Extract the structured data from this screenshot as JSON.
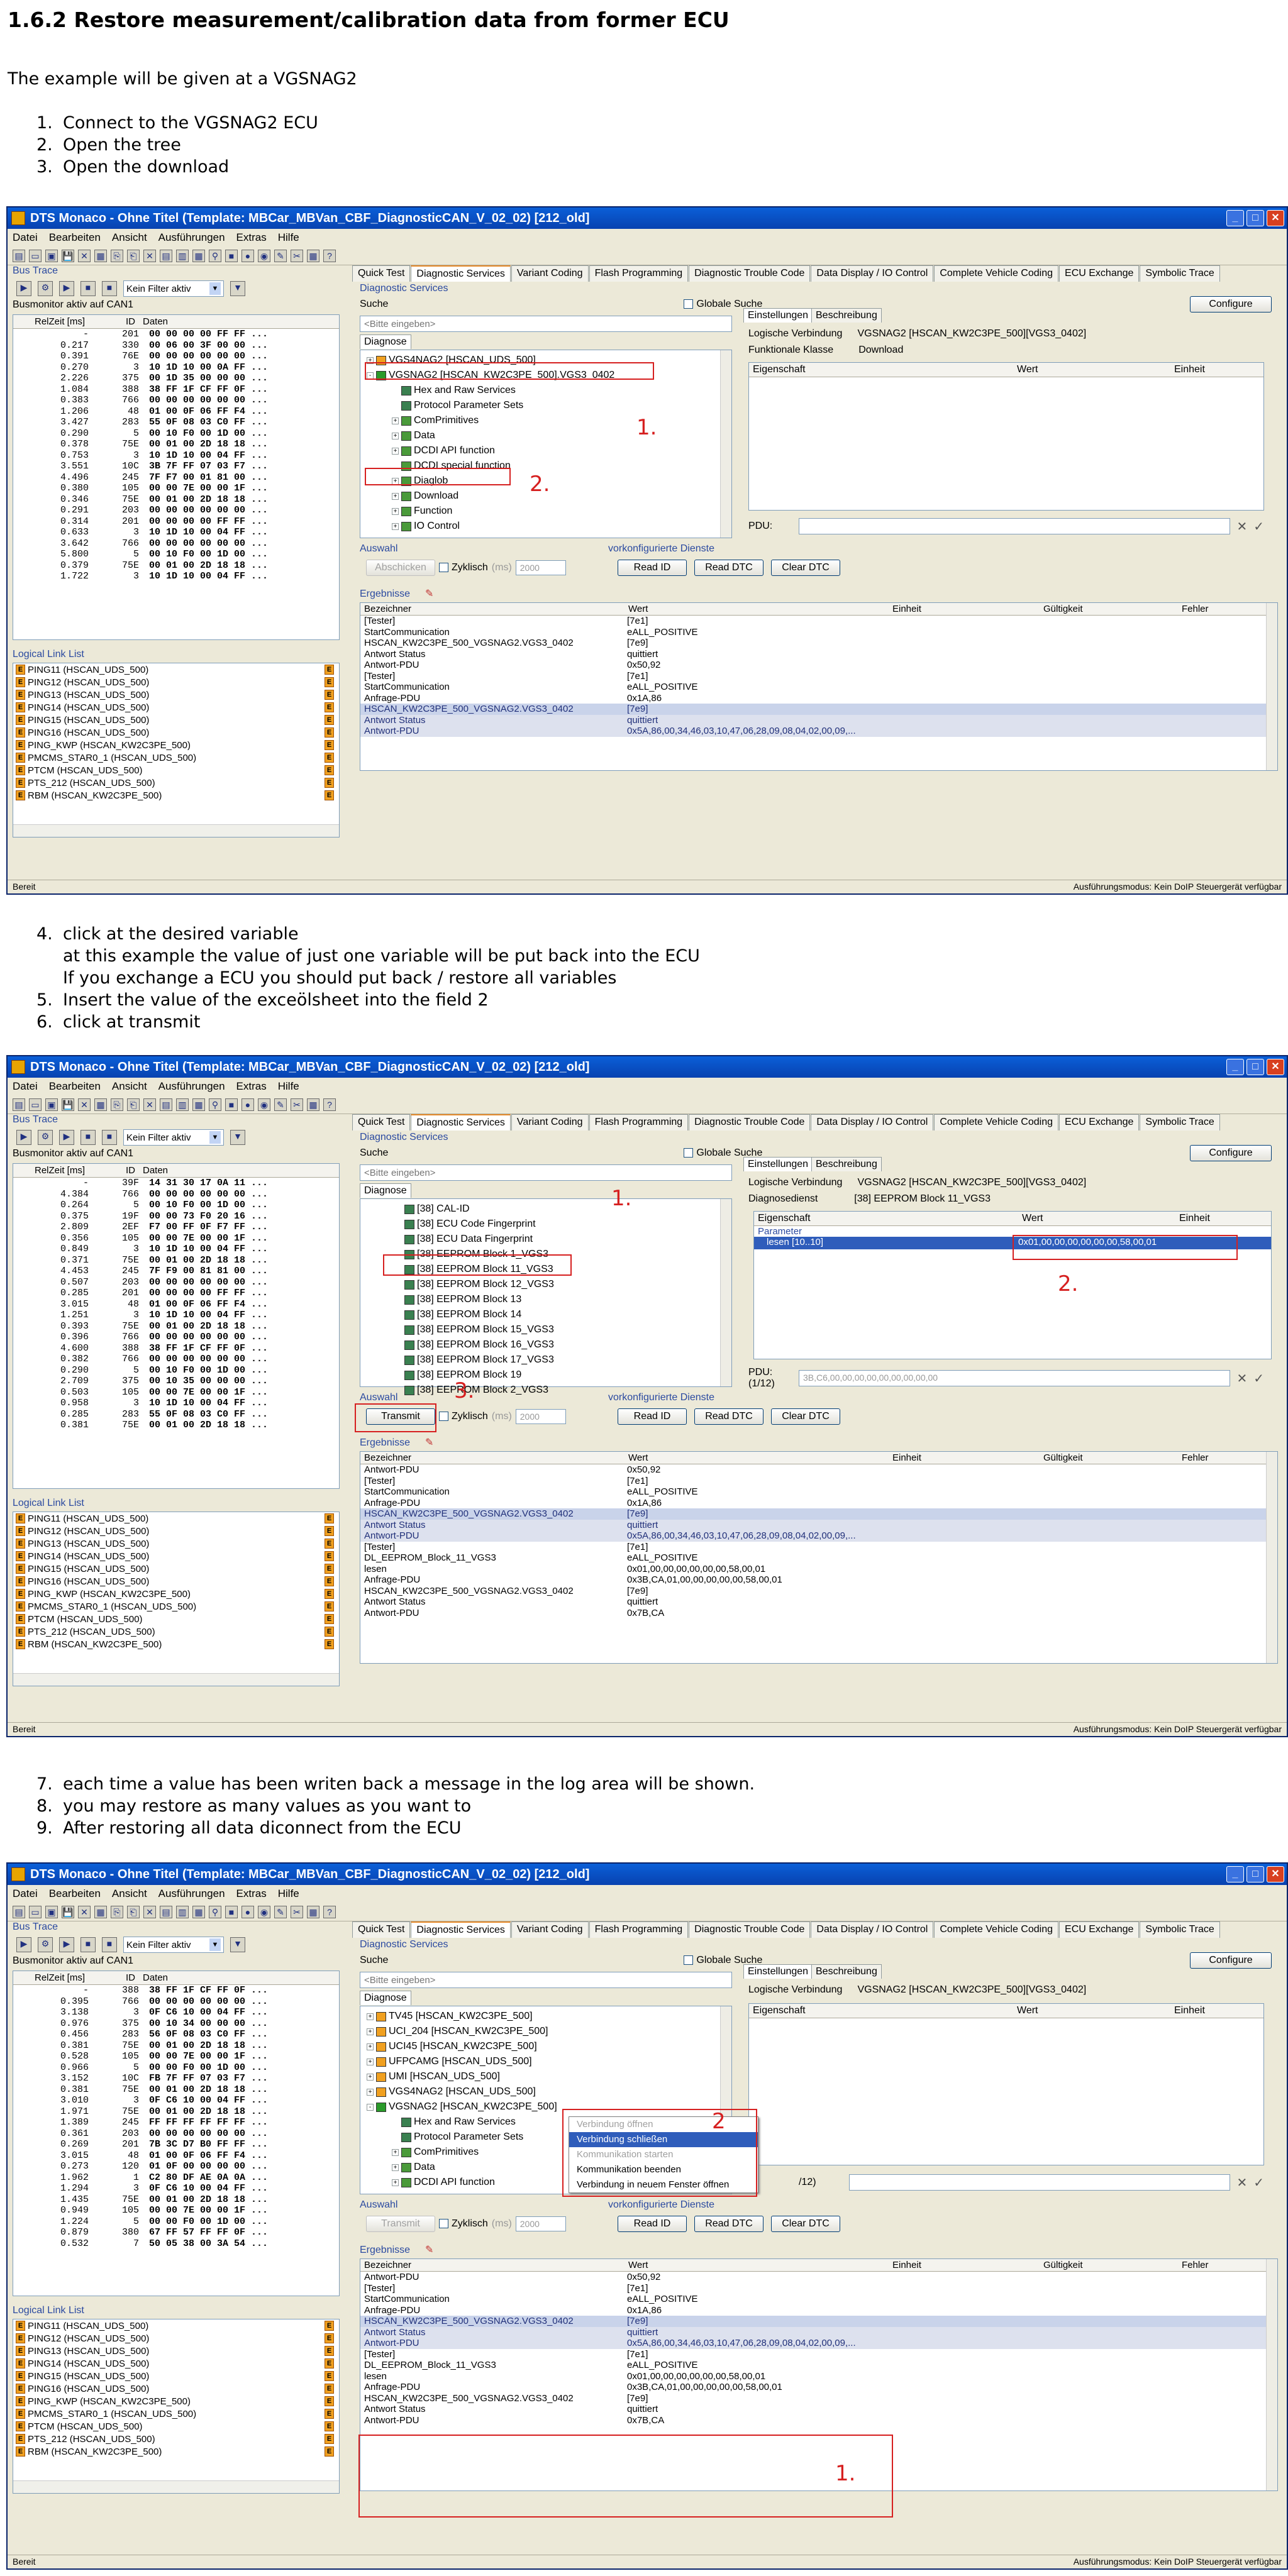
{
  "doc": {
    "heading": "1.6.2 Restore measurement/calibration data from former ECU",
    "intro": "The example will be given at a VGSNAG2",
    "steps_a": [
      {
        "n": "1.",
        "text": "Connect to the VGSNAG2 ECU"
      },
      {
        "n": "2.",
        "text": "Open the tree"
      },
      {
        "n": "3.",
        "text": "Open the download"
      }
    ],
    "steps_b": [
      {
        "n": "4.",
        "text": "click at the desired variable"
      },
      {
        "n": "",
        "text": "at this example the value of just one variable will be put back into the ECU"
      },
      {
        "n": "",
        "text": "If you exchange a ECU you should put back / restore all variables"
      },
      {
        "n": "5.",
        "text": "Insert the value of the exceölsheet into the field 2"
      },
      {
        "n": "6.",
        "text": "click at transmit"
      }
    ],
    "steps_c": [
      {
        "n": "7.",
        "text": "each time a value has been writen back a message in the log area will be shown."
      },
      {
        "n": "8.",
        "text": "you may restore as many values as you want to"
      },
      {
        "n": "9.",
        "text": "After restoring all data diconnect from the ECU"
      }
    ]
  },
  "window": {
    "title": "DTS Monaco - Ohne Titel (Template: MBCar_MBVan_CBF_DiagnosticCAN_V_02_02) [212_old]",
    "menu": [
      "Datei",
      "Bearbeiten",
      "Ansicht",
      "Ausführungen",
      "Extras",
      "Hilfe"
    ],
    "tabs": [
      "Quick Test",
      "Diagnostic Services",
      "Variant Coding",
      "Flash Programming",
      "Diagnostic Trouble Code",
      "Data Display / IO Control",
      "Complete Vehicle Coding",
      "ECU Exchange",
      "Symbolic Trace"
    ],
    "bus_trace": "Bus Trace",
    "filter": "Kein Filter aktiv",
    "busmonitor": "Busmonitor aktiv auf CAN1",
    "bus_cols": [
      "RelZeit [ms]",
      "ID",
      "Daten"
    ],
    "logical_link_list": "Logical Link List",
    "links": [
      "PING11 (HSCAN_UDS_500)",
      "PING12 (HSCAN_UDS_500)",
      "PING13 (HSCAN_UDS_500)",
      "PING14 (HSCAN_UDS_500)",
      "PING15 (HSCAN_UDS_500)",
      "PING16 (HSCAN_UDS_500)",
      "PING_KWP (HSCAN_KW2C3PE_500)",
      "PMCMS_STAR0_1 (HSCAN_UDS_500)",
      "PTCM (HSCAN_UDS_500)",
      "PTS_212 (HSCAN_UDS_500)",
      "RBM (HSCAN_KW2C3PE_500)"
    ],
    "diag_services": "Diagnostic Services",
    "suche": "Suche",
    "globale_suche": "Globale Suche",
    "configure": "Configure",
    "search_placeholder": "<Bitte eingeben>",
    "diagnose_tab": "Diagnose",
    "einstellungen_tab": "Einstellungen",
    "beschreibung_tab": "Beschreibung",
    "log_verb_label": "Logische Verbindung",
    "log_verb_value": "VGSNAG2 [HSCAN_KW2C3PE_500][VGS3_0402]",
    "props_cols": [
      "Eigenschaft",
      "Wert",
      "Einheit"
    ],
    "pdu": "PDU:",
    "auswahl": "Auswahl",
    "zyklisch": "Zyklisch",
    "ms": "(ms)",
    "cycle_value": "2000",
    "vorkonfig": "vorkonfigurierte Dienste",
    "read_id": "Read ID",
    "read_dtc": "Read DTC",
    "clear_dtc": "Clear DTC",
    "ergebnisse": "Ergebnisse",
    "res_cols": [
      "Bezeichner",
      "Wert",
      "Einheit",
      "Gültigkeit",
      "Fehler"
    ],
    "bereit": "Bereit",
    "ausf_mode": "Ausführungsmodus: Kein DoIP Steuergerät verfügbar"
  },
  "shot1": {
    "tree": [
      {
        "pm": "+",
        "ico": "e",
        "label": "VGS4NAG2 [HSCAN_UDS_500]",
        "indent": 0
      },
      {
        "pm": "-",
        "ico": "v",
        "label": "VGSNAG2 [HSCAN_KW2C3PE_500].VGS3_0402",
        "indent": 0
      },
      {
        "pm": "",
        "ico": "s",
        "label": "Hex and Raw Services",
        "indent": 1
      },
      {
        "pm": "",
        "ico": "s",
        "label": "Protocol Parameter Sets",
        "indent": 1
      },
      {
        "pm": "+",
        "ico": "g",
        "label": "ComPrimitives",
        "indent": 1
      },
      {
        "pm": "+",
        "ico": "g",
        "label": "Data",
        "indent": 1
      },
      {
        "pm": "+",
        "ico": "g",
        "label": "DCDI API function",
        "indent": 1
      },
      {
        "pm": "",
        "ico": "g",
        "label": "DCDI special function",
        "indent": 1
      },
      {
        "pm": "+",
        "ico": "g",
        "label": "Diaglob",
        "indent": 1
      },
      {
        "pm": "+",
        "ico": "g",
        "label": "Download",
        "indent": 1
      },
      {
        "pm": "+",
        "ico": "g",
        "label": "Function",
        "indent": 1
      },
      {
        "pm": "+",
        "ico": "g",
        "label": "IO Control",
        "indent": 1
      }
    ],
    "funk_label": "Funktionale Klasse",
    "funk_value": "Download",
    "abschicken": "Abschicken",
    "bus": [
      [
        "-",
        "201",
        "00 00 00 00 FF FF ..."
      ],
      [
        "0.217",
        "330",
        "00 06 00 3F 00 00 ..."
      ],
      [
        "0.391",
        "76E",
        "00 00 00 00 00 00 ..."
      ],
      [
        "0.270",
        "3",
        "10 1D 10 00 0A FF ..."
      ],
      [
        "2.226",
        "375",
        "00 1D 35 00 00 00 ..."
      ],
      [
        "1.084",
        "388",
        "38 FF 1F CF FF 0F ..."
      ],
      [
        "0.383",
        "766",
        "00 00 00 00 00 00 ..."
      ],
      [
        "1.206",
        "48",
        "01 00 0F 06 FF F4 ..."
      ],
      [
        "3.427",
        "283",
        "55 0F 08 03 C0 FF ..."
      ],
      [
        "0.290",
        "5",
        "00 10 F0 00 1D 00 ..."
      ],
      [
        "0.378",
        "75E",
        "00 01 00 2D 18 18 ..."
      ],
      [
        "0.753",
        "3",
        "10 1D 10 00 04 FF ..."
      ],
      [
        "3.551",
        "10C",
        "3B 7F FF 07 03 F7 ..."
      ],
      [
        "4.496",
        "245",
        "7F F7 00 01 81 00 ..."
      ],
      [
        "0.380",
        "105",
        "00 00 7E 00 00 1F ..."
      ],
      [
        "0.346",
        "75E",
        "00 01 00 2D 18 18 ..."
      ],
      [
        "0.291",
        "203",
        "00 00 00 00 00 00 ..."
      ],
      [
        "0.314",
        "201",
        "00 00 00 00 FF FF ..."
      ],
      [
        "0.633",
        "3",
        "10 1D 10 00 04 FF ..."
      ],
      [
        "3.642",
        "766",
        "00 00 00 00 00 00 ..."
      ],
      [
        "5.800",
        "5",
        "00 10 F0 00 1D 00 ..."
      ],
      [
        "0.379",
        "75E",
        "00 01 00 2D 18 18 ..."
      ],
      [
        "1.722",
        "3",
        "10 1D 10 00 04 FF ..."
      ]
    ],
    "results": [
      {
        "b": "[Tester]",
        "w": "[7e1]",
        "s": ""
      },
      {
        "b": "StartCommunication",
        "w": "eALL_POSITIVE",
        "s": ""
      },
      {
        "b": "HSCAN_KW2C3PE_500_VGSNAG2.VGS3_0402",
        "w": "[7e9]",
        "s": ""
      },
      {
        "b": "Antwort Status",
        "w": "quittiert",
        "s": ""
      },
      {
        "b": "Antwort-PDU",
        "w": "0x50,92",
        "s": ""
      },
      {
        "b": "[Tester]",
        "w": "[7e1]",
        "s": ""
      },
      {
        "b": "StartCommunication",
        "w": "eALL_POSITIVE",
        "s": ""
      },
      {
        "b": "Anfrage-PDU",
        "w": "0x1A,86",
        "s": ""
      },
      {
        "b": "HSCAN_KW2C3PE_500_VGSNAG2.VGS3_0402",
        "w": "[7e9]",
        "s": "s"
      },
      {
        "b": "Antwort Status",
        "w": "quittiert",
        "s": "s2"
      },
      {
        "b": "Antwort-PDU",
        "w": "0x5A,86,00,34,46,03,10,47,06,28,09,08,04,02,00,09,...",
        "s": "s2"
      }
    ],
    "callouts": [
      "1.",
      "2."
    ]
  },
  "shot2": {
    "tree": [
      {
        "label": "[38] CAL-ID"
      },
      {
        "label": "[38] ECU Code Fingerprint"
      },
      {
        "label": "[38] ECU Data Fingerprint"
      },
      {
        "label": "[38] EEPROM Block 1_VGS3"
      },
      {
        "label": "[38] EEPROM Block 11_VGS3"
      },
      {
        "label": "[38] EEPROM Block 12_VGS3"
      },
      {
        "label": "[38] EEPROM Block 13"
      },
      {
        "label": "[38] EEPROM Block 14"
      },
      {
        "label": "[38] EEPROM Block 15_VGS3"
      },
      {
        "label": "[38] EEPROM Block 16_VGS3"
      },
      {
        "label": "[38] EEPROM Block 17_VGS3"
      },
      {
        "label": "[38] EEPROM Block 19"
      },
      {
        "label": "[38] EEPROM Block 2_VGS3"
      }
    ],
    "dienst_label": "Diagnosedienst",
    "dienst_value": "[38] EEPROM Block 11_VGS3",
    "param_group": "Parameter",
    "param_name": "lesen [10..10]",
    "param_value": "0x01,00,00,00,00,00,00,58,00,01",
    "pdu": "PDU: (1/12)",
    "pdu_value": "3B,C6,00,00,00,00,00,00,00,00,00",
    "transmit": "Transmit",
    "bus": [
      [
        "-",
        "39F",
        "14 31 30 17 0A 11 ..."
      ],
      [
        "4.384",
        "766",
        "00 00 00 00 00 00 ..."
      ],
      [
        "0.264",
        "5",
        "00 10 F0 00 1D 00 ..."
      ],
      [
        "0.375",
        "19F",
        "00 00 73 F0 20 16 ..."
      ],
      [
        "2.809",
        "2EF",
        "F7 00 FF 0F F7 FF ..."
      ],
      [
        "0.356",
        "105",
        "00 00 7E 00 00 1F ..."
      ],
      [
        "0.849",
        "3",
        "10 1D 10 00 04 FF ..."
      ],
      [
        "0.371",
        "75E",
        "00 01 00 2D 18 18 ..."
      ],
      [
        "4.453",
        "245",
        "7F F9 00 81 81 00 ..."
      ],
      [
        "0.507",
        "203",
        "00 00 00 00 00 00 ..."
      ],
      [
        "0.285",
        "201",
        "00 00 00 00 FF FF ..."
      ],
      [
        "3.015",
        "48",
        "01 00 0F 06 FF F4 ..."
      ],
      [
        "1.251",
        "3",
        "10 1D 10 00 04 FF ..."
      ],
      [
        "0.393",
        "75E",
        "00 01 00 2D 18 18 ..."
      ],
      [
        "0.396",
        "766",
        "00 00 00 00 00 00 ..."
      ],
      [
        "4.600",
        "388",
        "38 FF 1F CF FF 0F ..."
      ],
      [
        "0.382",
        "766",
        "00 00 00 00 00 00 ..."
      ],
      [
        "0.290",
        "5",
        "00 10 F0 00 1D 00 ..."
      ],
      [
        "2.709",
        "375",
        "00 10 35 00 00 00 ..."
      ],
      [
        "0.503",
        "105",
        "00 00 7E 00 00 1F ..."
      ],
      [
        "0.958",
        "3",
        "10 1D 10 00 04 FF ..."
      ],
      [
        "0.285",
        "283",
        "55 0F 08 03 C0 FF ..."
      ],
      [
        "0.381",
        "75E",
        "00 01 00 2D 18 18 ..."
      ]
    ],
    "results": [
      {
        "b": "Antwort-PDU",
        "w": "0x50,92",
        "s": ""
      },
      {
        "b": "[Tester]",
        "w": "[7e1]",
        "s": ""
      },
      {
        "b": "StartCommunication",
        "w": "eALL_POSITIVE",
        "s": ""
      },
      {
        "b": "Anfrage-PDU",
        "w": "0x1A,86",
        "s": ""
      },
      {
        "b": "HSCAN_KW2C3PE_500_VGSNAG2.VGS3_0402",
        "w": "[7e9]",
        "s": "s"
      },
      {
        "b": "Antwort Status",
        "w": "quittiert",
        "s": "s2"
      },
      {
        "b": "Antwort-PDU",
        "w": "0x5A,86,00,34,46,03,10,47,06,28,09,08,04,02,00,09,...",
        "s": "s2"
      },
      {
        "b": "[Tester]",
        "w": "[7e1]",
        "s": ""
      },
      {
        "b": "DL_EEPROM_Block_11_VGS3",
        "w": "eALL_POSITIVE",
        "s": ""
      },
      {
        "b": "  lesen",
        "w": "0x01,00,00,00,00,00,00,58,00,01",
        "s": ""
      },
      {
        "b": "Anfrage-PDU",
        "w": "0x3B,CA,01,00,00,00,00,00,58,00,01",
        "s": ""
      },
      {
        "b": "HSCAN_KW2C3PE_500_VGSNAG2.VGS3_0402",
        "w": "[7e9]",
        "s": ""
      },
      {
        "b": "Antwort Status",
        "w": "quittiert",
        "s": ""
      },
      {
        "b": "Antwort-PDU",
        "w": "0x7B,CA",
        "s": ""
      }
    ],
    "callouts": [
      "1.",
      "2.",
      "3."
    ]
  },
  "shot3": {
    "tree": [
      {
        "pm": "+",
        "ico": "e",
        "label": "TV45 [HSCAN_KW2C3PE_500]",
        "indent": 0
      },
      {
        "pm": "+",
        "ico": "e",
        "label": "UCI_204 [HSCAN_KW2C3PE_500]",
        "indent": 0
      },
      {
        "pm": "+",
        "ico": "e",
        "label": "UCI45 [HSCAN_KW2C3PE_500]",
        "indent": 0
      },
      {
        "pm": "+",
        "ico": "e",
        "label": "UFPCAMG [HSCAN_UDS_500]",
        "indent": 0
      },
      {
        "pm": "+",
        "ico": "e",
        "label": "UMI [HSCAN_UDS_500]",
        "indent": 0
      },
      {
        "pm": "+",
        "ico": "e",
        "label": "VGS4NAG2 [HSCAN_UDS_500]",
        "indent": 0
      },
      {
        "pm": "-",
        "ico": "v",
        "label": "VGSNAG2 [HSCAN_KW2C3PE_500]",
        "indent": 0
      },
      {
        "pm": "",
        "ico": "s",
        "label": "Hex and Raw Services",
        "indent": 1
      },
      {
        "pm": "",
        "ico": "s",
        "label": "Protocol Parameter Sets",
        "indent": 1
      },
      {
        "pm": "+",
        "ico": "g",
        "label": "ComPrimitives",
        "indent": 1
      },
      {
        "pm": "+",
        "ico": "g",
        "label": "Data",
        "indent": 1
      },
      {
        "pm": "+",
        "ico": "g",
        "label": "DCDI API function",
        "indent": 1
      }
    ],
    "context_menu": [
      {
        "label": "Verbindung öffnen",
        "state": "dis"
      },
      {
        "label": "Verbindung schließen",
        "state": "sel"
      },
      {
        "label": "Kommunikation starten",
        "state": "dis"
      },
      {
        "label": "Kommunikation beenden",
        "state": ""
      },
      {
        "label": "Verbindung in neuem Fenster öffnen",
        "state": ""
      }
    ],
    "pdu_tail": "/12)",
    "bus": [
      [
        "-",
        "388",
        "38 FF 1F CF FF 0F ..."
      ],
      [
        "0.395",
        "766",
        "00 00 00 00 00 00 ..."
      ],
      [
        "3.138",
        "3",
        "0F C6 10 00 04 FF ..."
      ],
      [
        "0.976",
        "375",
        "00 10 34 00 00 00 ..."
      ],
      [
        "0.456",
        "283",
        "56 0F 08 03 C0 FF ..."
      ],
      [
        "0.381",
        "75E",
        "00 01 00 2D 18 18 ..."
      ],
      [
        "0.528",
        "105",
        "00 00 7E 00 00 1F ..."
      ],
      [
        "0.966",
        "5",
        "00 00 F0 00 1D 00 ..."
      ],
      [
        "3.152",
        "10C",
        "FB 7F FF 07 03 F7 ..."
      ],
      [
        "0.381",
        "75E",
        "00 01 00 2D 18 18 ..."
      ],
      [
        "3.010",
        "3",
        "0F C6 10 00 04 FF ..."
      ],
      [
        "1.971",
        "75E",
        "00 01 00 2D 18 18 ..."
      ],
      [
        "1.389",
        "245",
        "FF FF FF FF FF FF ..."
      ],
      [
        "0.361",
        "203",
        "00 00 00 00 00 00 ..."
      ],
      [
        "0.269",
        "201",
        "7B 3C D7 B0 FF FF ..."
      ],
      [
        "3.015",
        "48",
        "01 00 0F 06 FF F4 ..."
      ],
      [
        "0.273",
        "120",
        "01 0F 00 00 00 00 ..."
      ],
      [
        "1.962",
        "1",
        "C2 80 DF AE 0A 0A ..."
      ],
      [
        "1.294",
        "3",
        "0F C6 10 00 04 FF ..."
      ],
      [
        "1.435",
        "75E",
        "00 01 00 2D 18 18 ..."
      ],
      [
        "0.949",
        "105",
        "00 00 7E 00 00 1F ..."
      ],
      [
        "1.224",
        "5",
        "00 00 F0 00 1D 00 ..."
      ],
      [
        "0.879",
        "380",
        "67 FF 57 FF FF 0F ..."
      ],
      [
        "0.532",
        "7",
        "50 05 38 00 3A 54 ..."
      ]
    ],
    "results": [
      {
        "b": "Antwort-PDU",
        "w": "0x50,92",
        "s": ""
      },
      {
        "b": "[Tester]",
        "w": "[7e1]",
        "s": ""
      },
      {
        "b": "StartCommunication",
        "w": "eALL_POSITIVE",
        "s": ""
      },
      {
        "b": "Anfrage-PDU",
        "w": "0x1A,86",
        "s": ""
      },
      {
        "b": "HSCAN_KW2C3PE_500_VGSNAG2.VGS3_0402",
        "w": "[7e9]",
        "s": "s"
      },
      {
        "b": "Antwort Status",
        "w": "quittiert",
        "s": "s2"
      },
      {
        "b": "Antwort-PDU",
        "w": "0x5A,86,00,34,46,03,10,47,06,28,09,08,04,02,00,09,...",
        "s": "s2"
      },
      {
        "b": "[Tester]",
        "w": "[7e1]",
        "s": ""
      },
      {
        "b": "DL_EEPROM_Block_11_VGS3",
        "w": "eALL_POSITIVE",
        "s": ""
      },
      {
        "b": "  lesen",
        "w": "0x01,00,00,00,00,00,00,58,00,01",
        "s": ""
      },
      {
        "b": "Anfrage-PDU",
        "w": "0x3B,CA,01,00,00,00,00,00,58,00,01",
        "s": ""
      },
      {
        "b": "HSCAN_KW2C3PE_500_VGSNAG2.VGS3_0402",
        "w": "[7e9]",
        "s": ""
      },
      {
        "b": "Antwort Status",
        "w": "quittiert",
        "s": ""
      },
      {
        "b": "Antwort-PDU",
        "w": "0x7B,CA",
        "s": ""
      }
    ],
    "callouts": [
      "2",
      "1."
    ]
  }
}
